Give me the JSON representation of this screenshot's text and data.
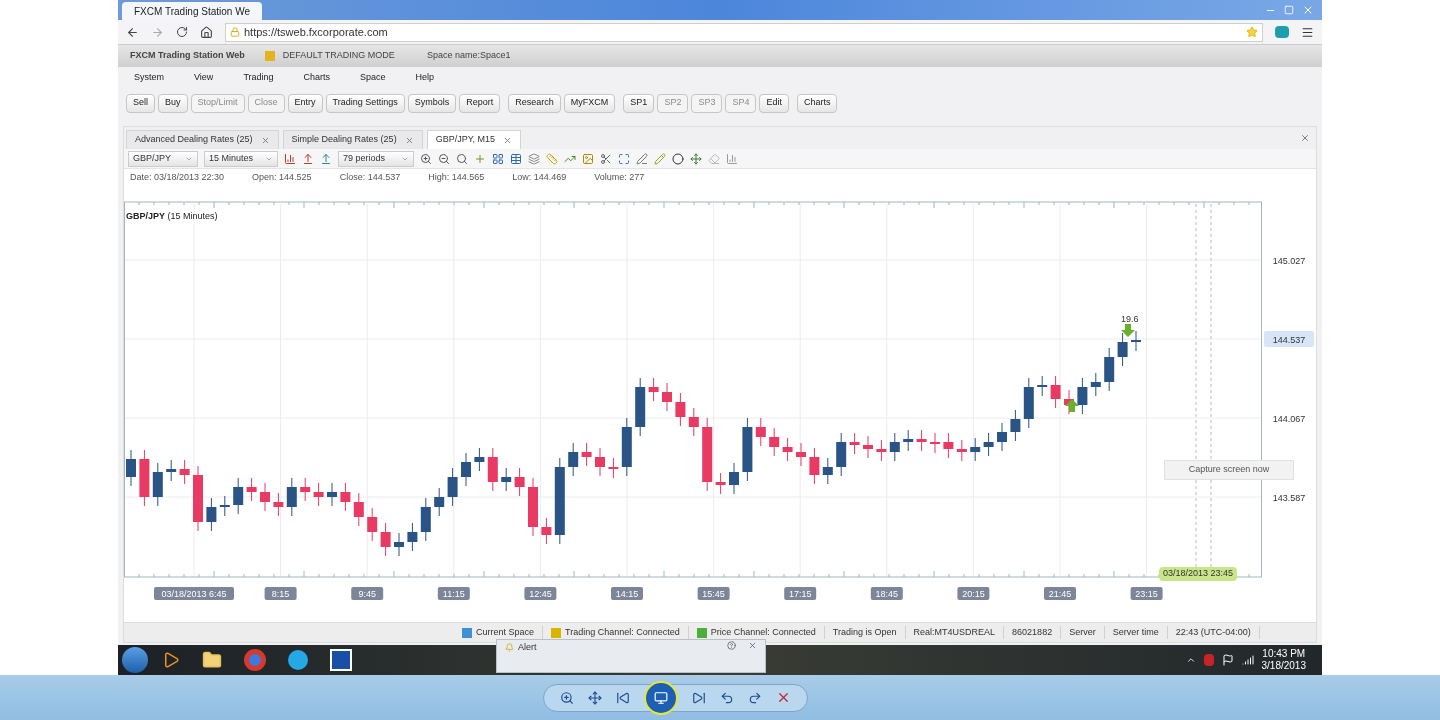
{
  "browser": {
    "tab_title": "FXCM Trading Station We",
    "url": "https://tsweb.fxcorporate.com"
  },
  "app_header": {
    "title": "FXCM Trading Station Web",
    "mode": "DEFAULT TRADING MODE",
    "space": "Space name:Space1"
  },
  "menu": [
    "System",
    "View",
    "Trading",
    "Charts",
    "Space",
    "Help"
  ],
  "toolbar_groups": [
    [
      {
        "label": "Sell",
        "disabled": false
      },
      {
        "label": "Buy",
        "disabled": false
      },
      {
        "label": "Stop/Limit",
        "disabled": true
      },
      {
        "label": "Close",
        "disabled": true
      },
      {
        "label": "Entry",
        "disabled": false
      },
      {
        "label": "Trading Settings",
        "disabled": false
      },
      {
        "label": "Symbols",
        "disabled": false
      },
      {
        "label": "Report",
        "disabled": false
      }
    ],
    [
      {
        "label": "Research",
        "disabled": false
      },
      {
        "label": "MyFXCM",
        "disabled": false
      }
    ],
    [
      {
        "label": "SP1",
        "disabled": false
      },
      {
        "label": "SP2",
        "disabled": true
      },
      {
        "label": "SP3",
        "disabled": true
      },
      {
        "label": "SP4",
        "disabled": true
      },
      {
        "label": "Edit",
        "disabled": false
      }
    ],
    [
      {
        "label": "Charts",
        "disabled": false
      }
    ]
  ],
  "tabs": [
    {
      "label": "Advanced Dealing Rates (25)",
      "selected": false
    },
    {
      "label": "Simple Dealing Rates (25)",
      "selected": false
    },
    {
      "label": "GBP/JPY, M15",
      "selected": true
    }
  ],
  "chart_toolbar": {
    "symbol": "GBP/JPY",
    "timeframe": "15 Minutes",
    "periods": "79 periods"
  },
  "bar_info": [
    "Date: 03/18/2013 22:30",
    "Open: 144.525",
    "Close: 144.537",
    "High: 144.565",
    "Low: 144.469",
    "Volume: 277"
  ],
  "chart": {
    "title": "**GBP/JPY** (15 Minutes)",
    "y_labels": [
      {
        "text": "145.027",
        "current": false
      },
      {
        "text": "144.537",
        "current": true
      },
      {
        "text": "144.067",
        "current": false
      },
      {
        "text": "143.587",
        "current": false
      }
    ],
    "x_labels": [
      "03/18/2013 6:45",
      "8:15",
      "9:45",
      "11:15",
      "12:45",
      "14:15",
      "15:45",
      "17:15",
      "18:45",
      "20:15",
      "21:45",
      "23:15"
    ],
    "marker_label": "19.6",
    "cursor_time": "03/18/2013 23:45",
    "tooltip": "Capture screen now"
  },
  "status_bar": [
    {
      "text": "Current Space",
      "color": "#3d8fd6"
    },
    {
      "text": "Trading Channel: Connected",
      "color": "#d9b400"
    },
    {
      "text": "Price Channel: Connected",
      "color": "#4caf3a"
    },
    {
      "text": "Trading is Open"
    },
    {
      "text": "Real:MT4USDREAL"
    },
    {
      "text": "86021882"
    },
    {
      "text": "Server"
    },
    {
      "text": "Server time"
    },
    {
      "text": "22:43 (UTC-04:00)"
    }
  ],
  "alert": {
    "title": "Alert"
  },
  "taskbar": {
    "time": "10:43 PM",
    "date": "3/18/2013"
  }
}
